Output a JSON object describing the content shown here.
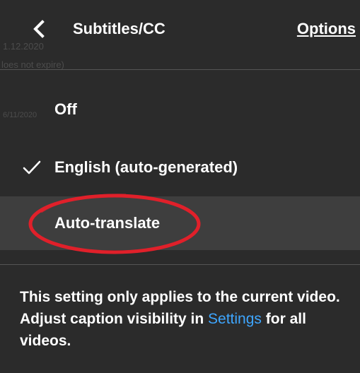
{
  "header": {
    "title": "Subtitles/CC",
    "options_label": "Options",
    "back_icon": "chevron-left-icon"
  },
  "background_text": {
    "line1": "1.12.2020",
    "line2": "loes not expire)",
    "line3": "6/11/2020"
  },
  "menu": {
    "items": [
      {
        "label": "Off",
        "checked": false
      },
      {
        "label": "English (auto-generated)",
        "checked": true
      },
      {
        "label": "Auto-translate",
        "checked": false,
        "highlighted": true
      }
    ]
  },
  "info": {
    "text_before": "This setting only applies to the current video. Adjust caption visibility in ",
    "settings_link": "Settings",
    "text_after": " for all videos."
  },
  "colors": {
    "panel_bg": "#2b2b2b",
    "highlight_row": "#3e3e3e",
    "link": "#3ea6ff",
    "annotation_ring": "#e0202a"
  }
}
